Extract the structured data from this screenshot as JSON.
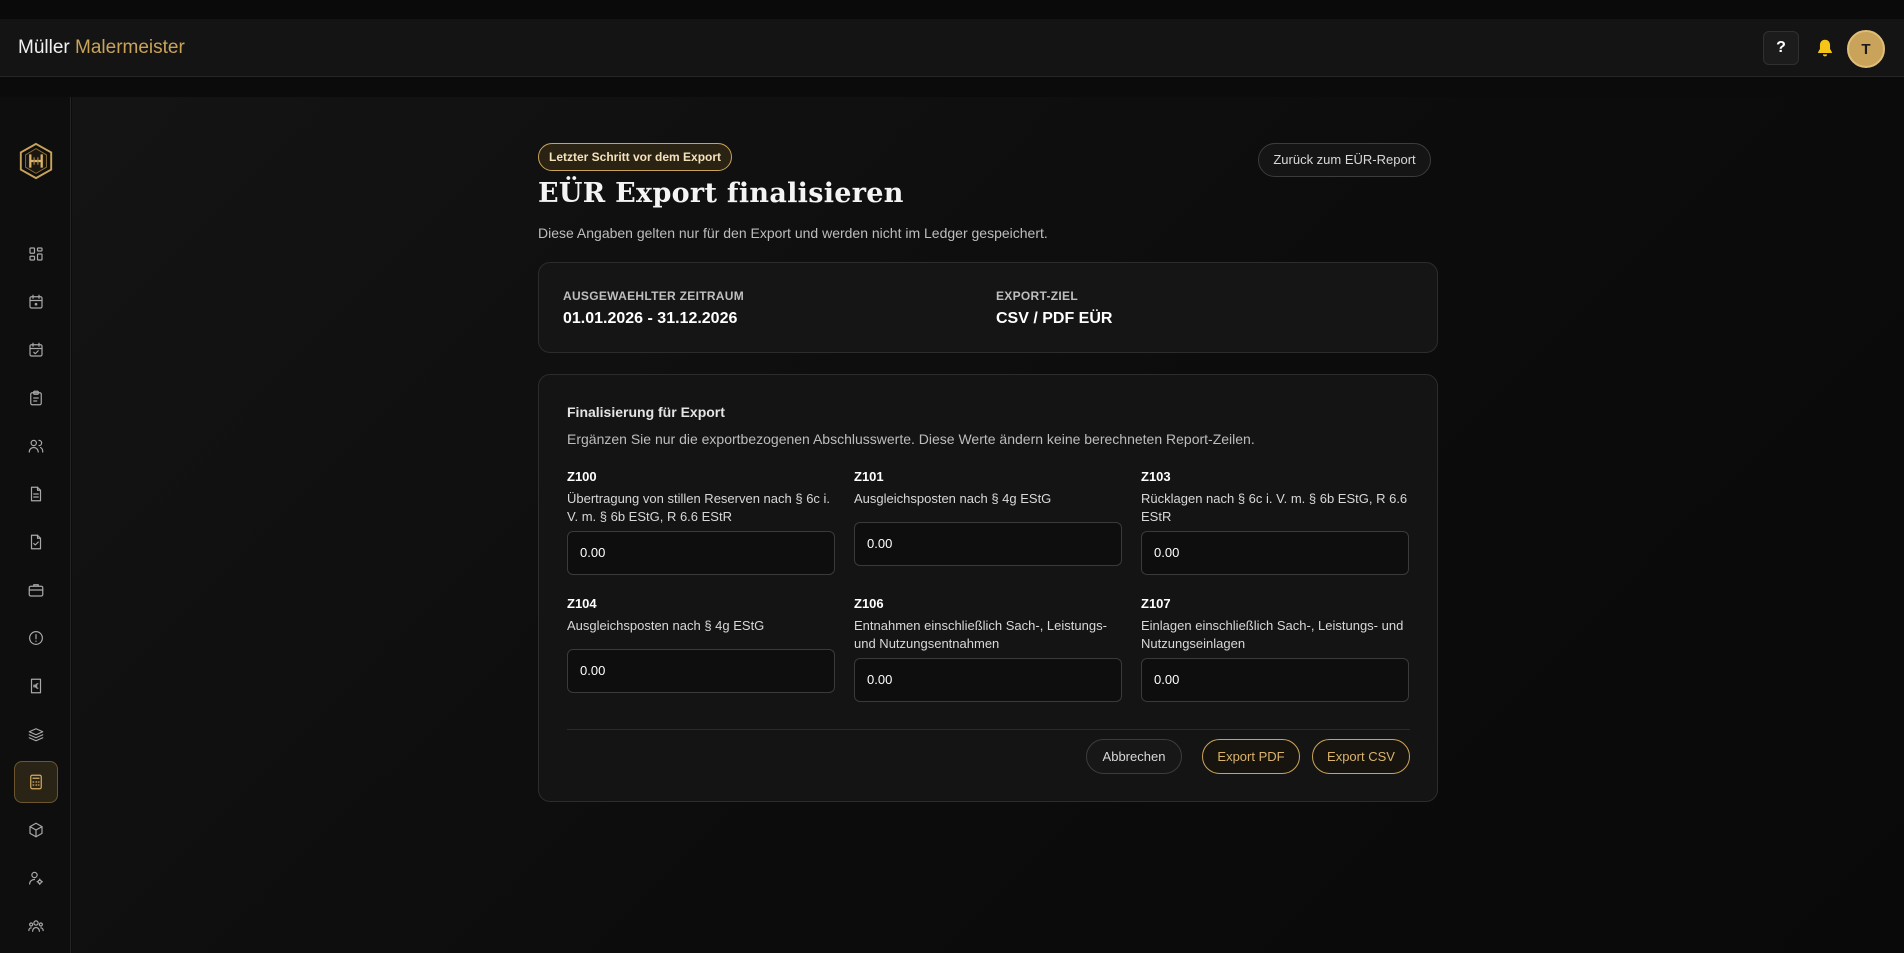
{
  "header": {
    "brand_name": "Müller",
    "brand_accent": "Malermeister",
    "help_label": "?",
    "avatar_initial": "T",
    "bell_icon": "bell-icon"
  },
  "sidebar": {
    "items": [
      {
        "name": "dashboard",
        "icon": "grid-icon"
      },
      {
        "name": "calendar",
        "icon": "calendar-icon"
      },
      {
        "name": "calendar-check",
        "icon": "calendar-check-icon"
      },
      {
        "name": "clipboard",
        "icon": "clipboard-icon"
      },
      {
        "name": "users",
        "icon": "users-icon"
      },
      {
        "name": "document",
        "icon": "document-icon"
      },
      {
        "name": "document-check",
        "icon": "document-check-icon"
      },
      {
        "name": "briefcase",
        "icon": "briefcase-icon"
      },
      {
        "name": "alert",
        "icon": "alert-circle-icon"
      },
      {
        "name": "euro-receipt",
        "icon": "euro-receipt-icon"
      },
      {
        "name": "stack",
        "icon": "stack-icon"
      },
      {
        "name": "calculator",
        "icon": "calculator-icon",
        "active": true
      },
      {
        "name": "box",
        "icon": "box-icon"
      },
      {
        "name": "user-settings",
        "icon": "user-gear-icon"
      },
      {
        "name": "team",
        "icon": "team-icon"
      }
    ]
  },
  "page": {
    "badge": "Letzter Schritt vor dem Export",
    "back_button": "Zurück zum EÜR-Report",
    "title": "EÜR Export finalisieren",
    "subtitle": "Diese Angaben gelten nur für den Export und werden nicht im Ledger gespeichert."
  },
  "period": {
    "range_label": "AUSGEWAEHLTER ZEITRAUM",
    "range_value": "01.01.2026 - 31.12.2026",
    "target_label": "EXPORT-ZIEL",
    "target_value": "CSV / PDF EÜR"
  },
  "form": {
    "title": "Finalisierung für Export",
    "description": "Ergänzen Sie nur die exportbezogenen Abschlusswerte. Diese Werte ändern keine berechneten Report-Zeilen.",
    "fields": [
      {
        "code": "Z100",
        "label": "Übertragung von stillen Reserven nach § 6c i. V. m. § 6b EStG, R 6.6 EStR",
        "value": "0.00"
      },
      {
        "code": "Z101",
        "label": "Ausgleichsposten nach § 4g EStG",
        "value": "0.00"
      },
      {
        "code": "Z103",
        "label": "Rücklagen nach § 6c i. V. m. § 6b EStG, R 6.6 EStR",
        "value": "0.00"
      },
      {
        "code": "Z104",
        "label": "Ausgleichsposten nach § 4g EStG",
        "value": "0.00"
      },
      {
        "code": "Z106",
        "label": "Entnahmen einschließlich Sach-, Leistungs- und Nutzungsentnahmen",
        "value": "0.00"
      },
      {
        "code": "Z107",
        "label": "Einlagen einschließlich Sach-, Leistungs- und Nutzungseinlagen",
        "value": "0.00"
      }
    ],
    "cancel_label": "Abbrechen",
    "export_pdf_label": "Export PDF",
    "export_csv_label": "Export CSV"
  },
  "colors": {
    "accent": "#c9a35a",
    "background": "#0b0b0b",
    "card": "#151515"
  }
}
